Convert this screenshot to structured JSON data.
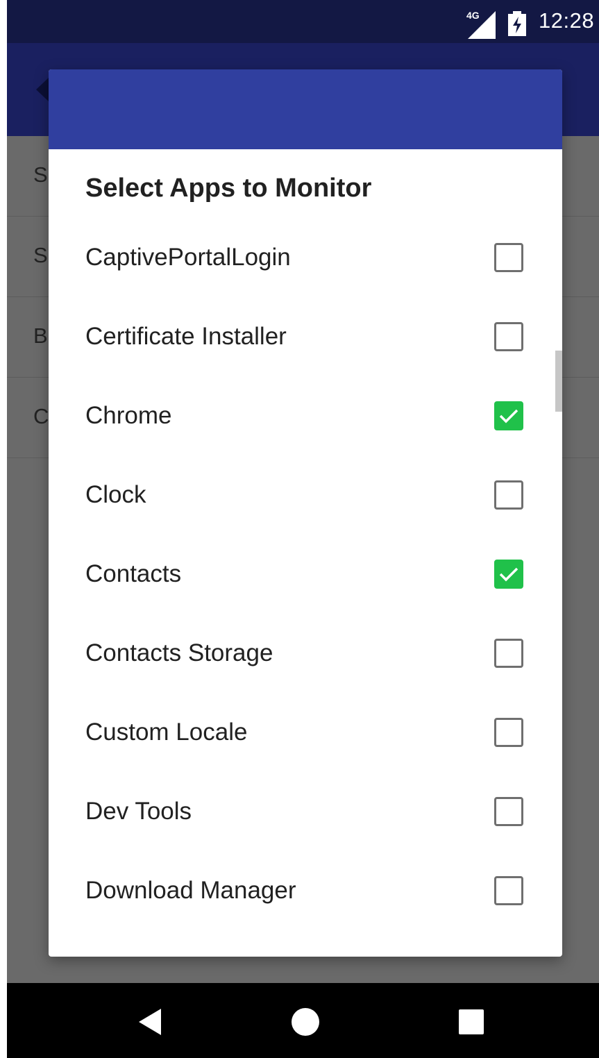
{
  "status_bar": {
    "network": "4G",
    "time": "12:28"
  },
  "background_list": {
    "rows": [
      {
        "initial": "S"
      },
      {
        "initial": "S"
      },
      {
        "initial": "B"
      },
      {
        "initial": "C"
      }
    ]
  },
  "dialog": {
    "title": "Select Apps to Monitor",
    "items": [
      {
        "label": "CaptivePortalLogin",
        "checked": false
      },
      {
        "label": "Certificate Installer",
        "checked": false
      },
      {
        "label": "Chrome",
        "checked": true
      },
      {
        "label": "Clock",
        "checked": false
      },
      {
        "label": "Contacts",
        "checked": true
      },
      {
        "label": "Contacts Storage",
        "checked": false
      },
      {
        "label": "Custom Locale",
        "checked": false
      },
      {
        "label": "Dev Tools",
        "checked": false
      },
      {
        "label": "Download Manager",
        "checked": false
      }
    ],
    "accent_color": "#303f9f",
    "check_color": "#20c14a"
  },
  "nav_bar": {
    "buttons": [
      "back-icon",
      "home-icon",
      "recents-icon"
    ]
  }
}
